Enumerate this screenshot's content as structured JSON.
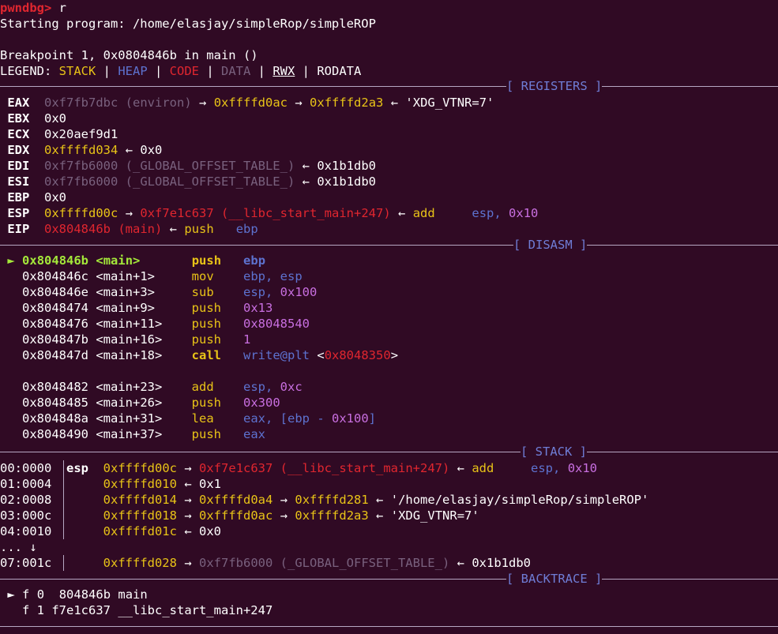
{
  "terminal": {
    "prompt": "pwndbg>",
    "command": "r",
    "start_line": "Starting program: /home/elasjay/simpleRop/simpleROP",
    "breakpoint_line": "Breakpoint 1, 0x0804846b in main ()",
    "legend": {
      "label": "LEGEND:",
      "stack": "STACK",
      "heap": "HEAP",
      "code": "CODE",
      "data": "DATA",
      "rwx": "RWX",
      "rodata": "RODATA",
      "sep": " | "
    }
  },
  "symbols": {
    "arrow": "→",
    "back": "←",
    "pointer": "►",
    "down": "↓",
    "ellipsis": "..."
  },
  "sections": {
    "registers": "[ REGISTERS ]",
    "disasm": "[ DISASM ]",
    "stack": "[ STACK ]",
    "backtrace": "[ BACKTRACE ]"
  },
  "registers": {
    "eax": {
      "name": "EAX",
      "a": "0xf7fb7dbc (environ)",
      "b": "0xffffd0ac",
      "c": "0xffffd2a3",
      "d": "'XDG_VTNR=7'"
    },
    "ebx": {
      "name": "EBX",
      "v": "0x0"
    },
    "ecx": {
      "name": "ECX",
      "v": "0x20aef9d1"
    },
    "edx": {
      "name": "EDX",
      "a": "0xffffd034",
      "b": "0x0"
    },
    "edi": {
      "name": "EDI",
      "a": "0xf7fb6000 (_GLOBAL_OFFSET_TABLE_)",
      "b": "0x1b1db0"
    },
    "esi": {
      "name": "ESI",
      "a": "0xf7fb6000 (_GLOBAL_OFFSET_TABLE_)",
      "b": "0x1b1db0"
    },
    "ebp": {
      "name": "EBP",
      "v": "0x0"
    },
    "esp": {
      "name": "ESP",
      "a": "0xffffd00c",
      "b": "0xf7e1c637 (__libc_start_main+247)",
      "op": "add",
      "arg1": "esp,",
      "arg2": "0x10"
    },
    "eip": {
      "name": "EIP",
      "a": "0x804846b (main)",
      "op": "push",
      "arg": "ebp"
    }
  },
  "disasm": [
    {
      "addr": "0x804846b",
      "sym": "<main>",
      "op": "push",
      "a": "ebp",
      "b": ""
    },
    {
      "addr": "0x804846c",
      "sym": "<main+1>",
      "op": "mov",
      "a": "ebp, esp",
      "b": ""
    },
    {
      "addr": "0x804846e",
      "sym": "<main+3>",
      "op": "sub",
      "a": "esp,",
      "b": "0x100"
    },
    {
      "addr": "0x8048474",
      "sym": "<main+9>",
      "op": "push",
      "a": "",
      "b": "0x13"
    },
    {
      "addr": "0x8048476",
      "sym": "<main+11>",
      "op": "push",
      "a": "0x8048540",
      "b": ""
    },
    {
      "addr": "0x804847b",
      "sym": "<main+16>",
      "op": "push",
      "a": "",
      "b": "1"
    },
    {
      "addr": "0x804847d",
      "sym": "<main+18>",
      "op": "call",
      "a": "write@plt",
      "lt": "<",
      "b": "0x8048350",
      "gt": ">"
    },
    {
      "addr": "0x8048482",
      "sym": "<main+23>",
      "op": "add",
      "a": "esp,",
      "b": "0xc"
    },
    {
      "addr": "0x8048485",
      "sym": "<main+26>",
      "op": "push",
      "a": "",
      "b": "0x300"
    },
    {
      "addr": "0x804848a",
      "sym": "<main+31>",
      "op": "lea",
      "a": "eax, [ebp -",
      "b": "0x100",
      "c": "]"
    },
    {
      "addr": "0x8048490",
      "sym": "<main+37>",
      "op": "push",
      "a": "eax",
      "b": ""
    }
  ],
  "stack": [
    {
      "idx": "00:0000",
      "reg": "esp",
      "a": "0xffffd00c",
      "b": "0xf7e1c637 (__libc_start_main+247)",
      "op": "add",
      "arg1": "esp,",
      "arg2": "0x10"
    },
    {
      "idx": "01:0004",
      "a": "0xffffd010",
      "v": "0x1"
    },
    {
      "idx": "02:0008",
      "a": "0xffffd014",
      "b": "0xffffd0a4",
      "c": "0xffffd281",
      "d": "'/home/elasjay/simpleRop/simpleROP'"
    },
    {
      "idx": "03:000c",
      "a": "0xffffd018",
      "b": "0xffffd0ac",
      "c": "0xffffd2a3",
      "d": "'XDG_VTNR=7'"
    },
    {
      "idx": "04:0010",
      "a": "0xffffd01c",
      "v": "0x0"
    },
    {
      "idx": "07:001c",
      "a": "0xffffd028",
      "b": "0xf7fb6000 (_GLOBAL_OFFSET_TABLE_)",
      "v": "0x1b1db0"
    }
  ],
  "backtrace": [
    {
      "frame": "f 0",
      "text": "804846b main"
    },
    {
      "frame": "f 1",
      "text": "f7e1c637 __libc_start_main+247"
    }
  ],
  "colors": {
    "background": "#300a24",
    "stack": "#e8c317",
    "heap": "#5d72cf",
    "code": "#e0262f",
    "data": "#79617e",
    "string": "#ffffff",
    "current": "#a4e83a",
    "number": "#c86fe0",
    "header": "#6f7dd6"
  }
}
